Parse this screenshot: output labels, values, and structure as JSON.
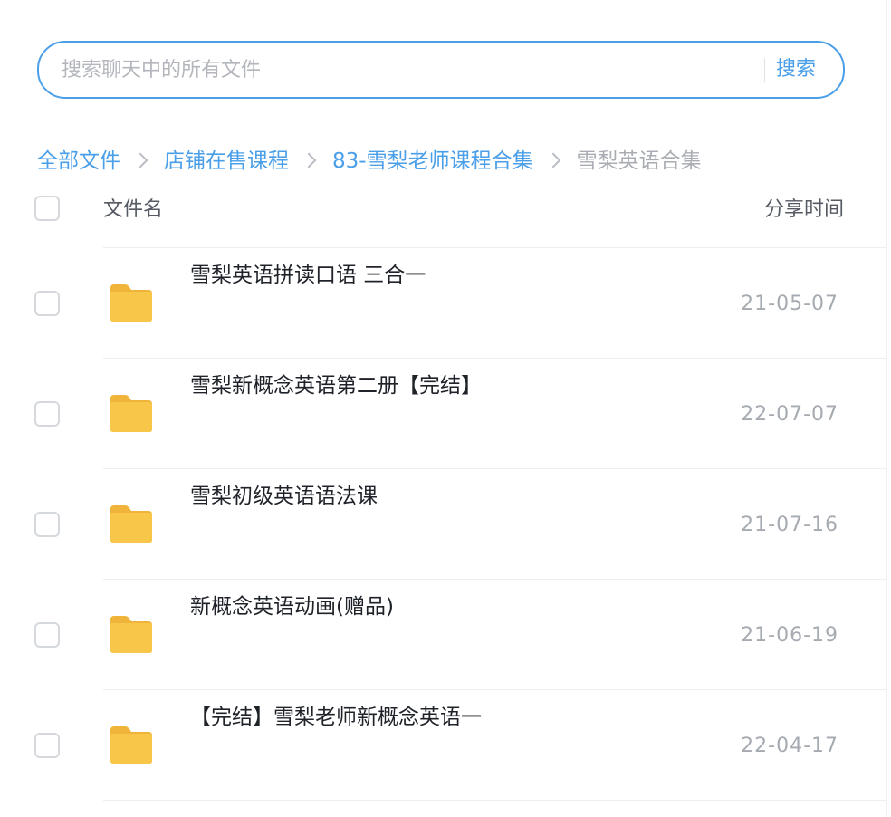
{
  "search": {
    "placeholder": "搜索聊天中的所有文件",
    "value": "",
    "button_label": "搜索"
  },
  "breadcrumb": [
    {
      "label": "全部文件"
    },
    {
      "label": "店铺在售课程"
    },
    {
      "label": "83-雪梨老师课程合集"
    },
    {
      "label": "雪梨英语合集"
    }
  ],
  "table": {
    "columns": {
      "name": "文件名",
      "time": "分享时间"
    },
    "rows": [
      {
        "name": "雪梨英语拼读口语 三合一",
        "date": "21-05-07",
        "icon": "folder-icon"
      },
      {
        "name": "雪梨新概念英语第二册【完结】",
        "date": "22-07-07",
        "icon": "folder-icon"
      },
      {
        "name": "雪梨初级英语语法课",
        "date": "21-07-16",
        "icon": "folder-icon"
      },
      {
        "name": "新概念英语动画(赠品)",
        "date": "21-06-19",
        "icon": "folder-icon"
      },
      {
        "name": "【完结】雪梨老师新概念英语一",
        "date": "22-04-17",
        "icon": "folder-icon"
      }
    ]
  },
  "colors": {
    "accent": "#4a9fe8",
    "folder": "#f8c74a",
    "text_primary": "#1f2329",
    "text_muted": "#a6abb2"
  }
}
